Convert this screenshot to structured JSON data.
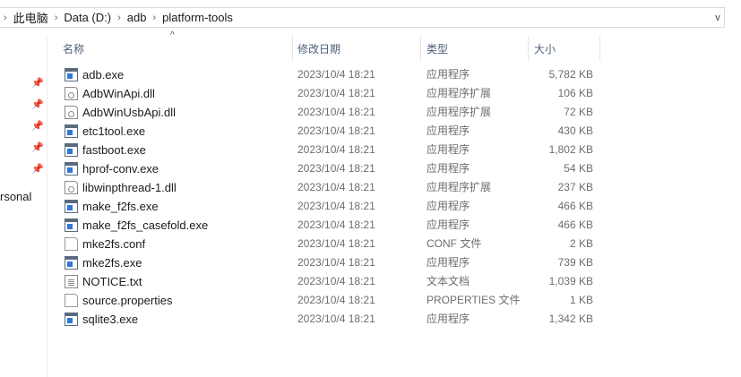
{
  "address_bar": {
    "crumbs": [
      "此电脑",
      "Data (D:)",
      "adb",
      "platform-tools"
    ],
    "separator": "›",
    "dropdown": "v"
  },
  "sidebar": {
    "pins": [
      "📌",
      "📌",
      "📌",
      "📌",
      "📌"
    ],
    "label": "rsonal"
  },
  "columns": {
    "name": "名称",
    "date": "修改日期",
    "type": "类型",
    "size": "大小",
    "sort_indicator": "^"
  },
  "files": [
    {
      "name": "adb.exe",
      "date": "2023/10/4 18:21",
      "type": "应用程序",
      "size": "5,782 KB",
      "icon": "exe"
    },
    {
      "name": "AdbWinApi.dll",
      "date": "2023/10/4 18:21",
      "type": "应用程序扩展",
      "size": "106 KB",
      "icon": "dll"
    },
    {
      "name": "AdbWinUsbApi.dll",
      "date": "2023/10/4 18:21",
      "type": "应用程序扩展",
      "size": "72 KB",
      "icon": "dll"
    },
    {
      "name": "etc1tool.exe",
      "date": "2023/10/4 18:21",
      "type": "应用程序",
      "size": "430 KB",
      "icon": "exe"
    },
    {
      "name": "fastboot.exe",
      "date": "2023/10/4 18:21",
      "type": "应用程序",
      "size": "1,802 KB",
      "icon": "exe"
    },
    {
      "name": "hprof-conv.exe",
      "date": "2023/10/4 18:21",
      "type": "应用程序",
      "size": "54 KB",
      "icon": "exe"
    },
    {
      "name": "libwinpthread-1.dll",
      "date": "2023/10/4 18:21",
      "type": "应用程序扩展",
      "size": "237 KB",
      "icon": "dll"
    },
    {
      "name": "make_f2fs.exe",
      "date": "2023/10/4 18:21",
      "type": "应用程序",
      "size": "466 KB",
      "icon": "exe"
    },
    {
      "name": "make_f2fs_casefold.exe",
      "date": "2023/10/4 18:21",
      "type": "应用程序",
      "size": "466 KB",
      "icon": "exe"
    },
    {
      "name": "mke2fs.conf",
      "date": "2023/10/4 18:21",
      "type": "CONF 文件",
      "size": "2 KB",
      "icon": "doc"
    },
    {
      "name": "mke2fs.exe",
      "date": "2023/10/4 18:21",
      "type": "应用程序",
      "size": "739 KB",
      "icon": "exe"
    },
    {
      "name": "NOTICE.txt",
      "date": "2023/10/4 18:21",
      "type": "文本文档",
      "size": "1,039 KB",
      "icon": "txt"
    },
    {
      "name": "source.properties",
      "date": "2023/10/4 18:21",
      "type": "PROPERTIES 文件",
      "size": "1 KB",
      "icon": "doc"
    },
    {
      "name": "sqlite3.exe",
      "date": "2023/10/4 18:21",
      "type": "应用程序",
      "size": "1,342 KB",
      "icon": "exe"
    }
  ]
}
